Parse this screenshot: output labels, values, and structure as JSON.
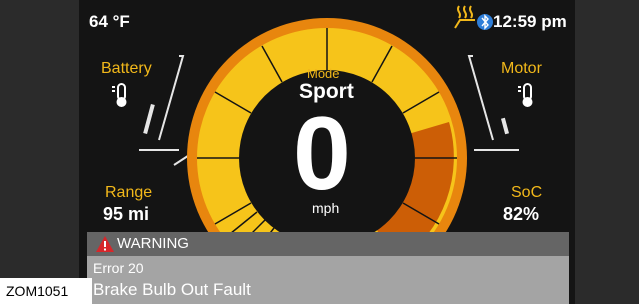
{
  "status_bar": {
    "temperature": "64 °F",
    "clock": "12:59 pm",
    "icons": {
      "heated_seat": "heated-seat-icon",
      "bluetooth": "bluetooth-icon"
    }
  },
  "battery": {
    "label": "Battery",
    "icon": "thermometer-icon"
  },
  "motor": {
    "label": "Motor",
    "icon": "thermometer-icon"
  },
  "mode": {
    "label": "Mode",
    "value": "Sport"
  },
  "speed": {
    "value": "0",
    "unit": "mph"
  },
  "range": {
    "label": "Range",
    "value": "95 mi"
  },
  "soc": {
    "label": "SoC",
    "value": "82%",
    "level": 0.82
  },
  "warning": {
    "title": "WARNING",
    "icon": "warning-triangle-icon",
    "code": "Error 20",
    "message": "Brake Bulb Out Fault"
  },
  "figure_label": "ZOM1051",
  "colors": {
    "background": "#141414",
    "accent_yellow": "#f2b81a",
    "gauge_yellow": "#f6c41a",
    "gauge_orange": "#e8860e",
    "gauge_dark_orange": "#cc5e06",
    "warning_red": "#d7262a",
    "side_panel": "#2b2b2b"
  }
}
